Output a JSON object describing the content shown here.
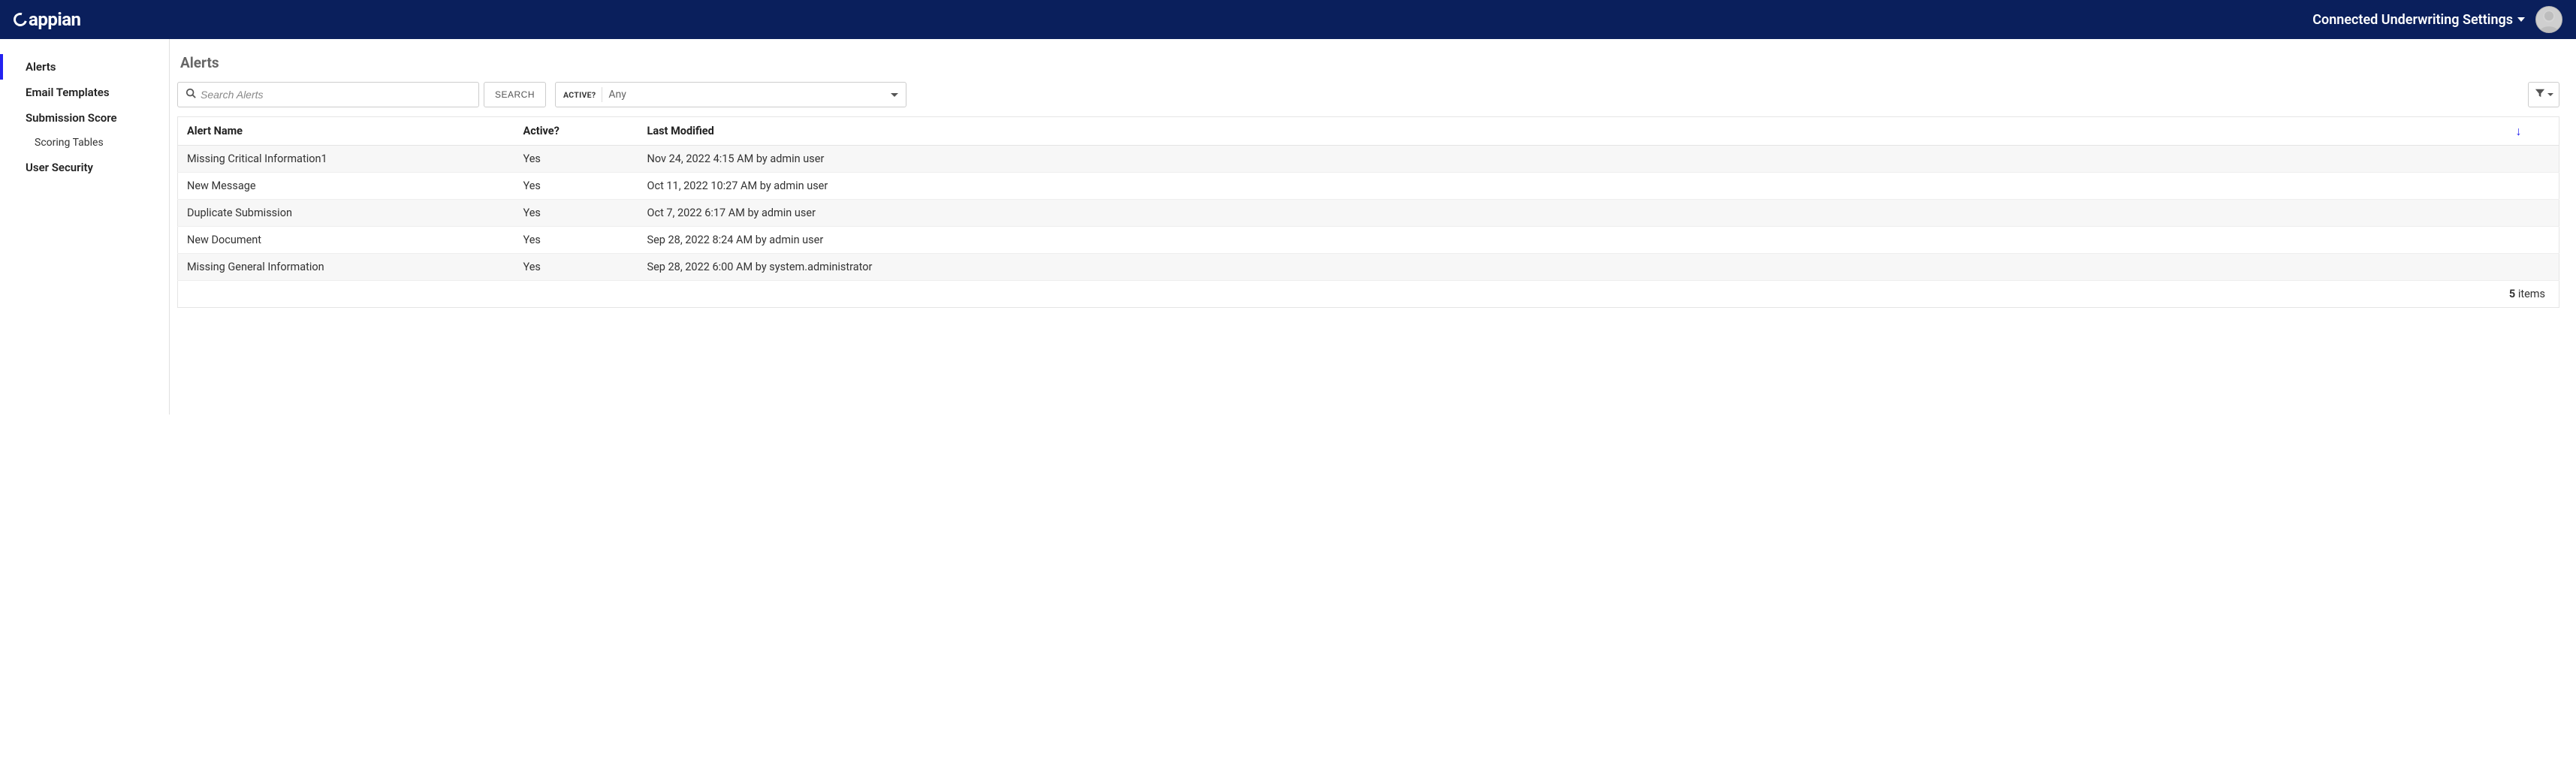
{
  "header": {
    "logo_text": "appian",
    "title": "Connected Underwriting Settings"
  },
  "sidebar": {
    "items": [
      {
        "label": "Alerts",
        "active": true
      },
      {
        "label": "Email Templates",
        "active": false
      },
      {
        "label": "Submission Score",
        "active": false
      },
      {
        "label": "User Security",
        "active": false
      }
    ],
    "sub_items": {
      "scoring_tables": "Scoring Tables"
    }
  },
  "page": {
    "title": "Alerts"
  },
  "search": {
    "placeholder": "Search Alerts",
    "button_label": "SEARCH"
  },
  "active_filter": {
    "label": "ACTIVE?",
    "value": "Any"
  },
  "table": {
    "columns": {
      "name": "Alert Name",
      "active": "Active?",
      "modified": "Last Modified"
    },
    "rows": [
      {
        "name": "Missing Critical Information1",
        "active": "Yes",
        "modified": "Nov 24, 2022 4:15 AM by admin user"
      },
      {
        "name": "New Message",
        "active": "Yes",
        "modified": "Oct 11, 2022 10:27 AM by admin user"
      },
      {
        "name": "Duplicate Submission",
        "active": "Yes",
        "modified": "Oct 7, 2022 6:17 AM by admin user"
      },
      {
        "name": "New Document",
        "active": "Yes",
        "modified": "Sep 28, 2022 8:24 AM by admin user"
      },
      {
        "name": "Missing General Information",
        "active": "Yes",
        "modified": "Sep 28, 2022 6:00 AM by system.administrator"
      }
    ],
    "footer": {
      "count": "5",
      "suffix": " items"
    }
  }
}
